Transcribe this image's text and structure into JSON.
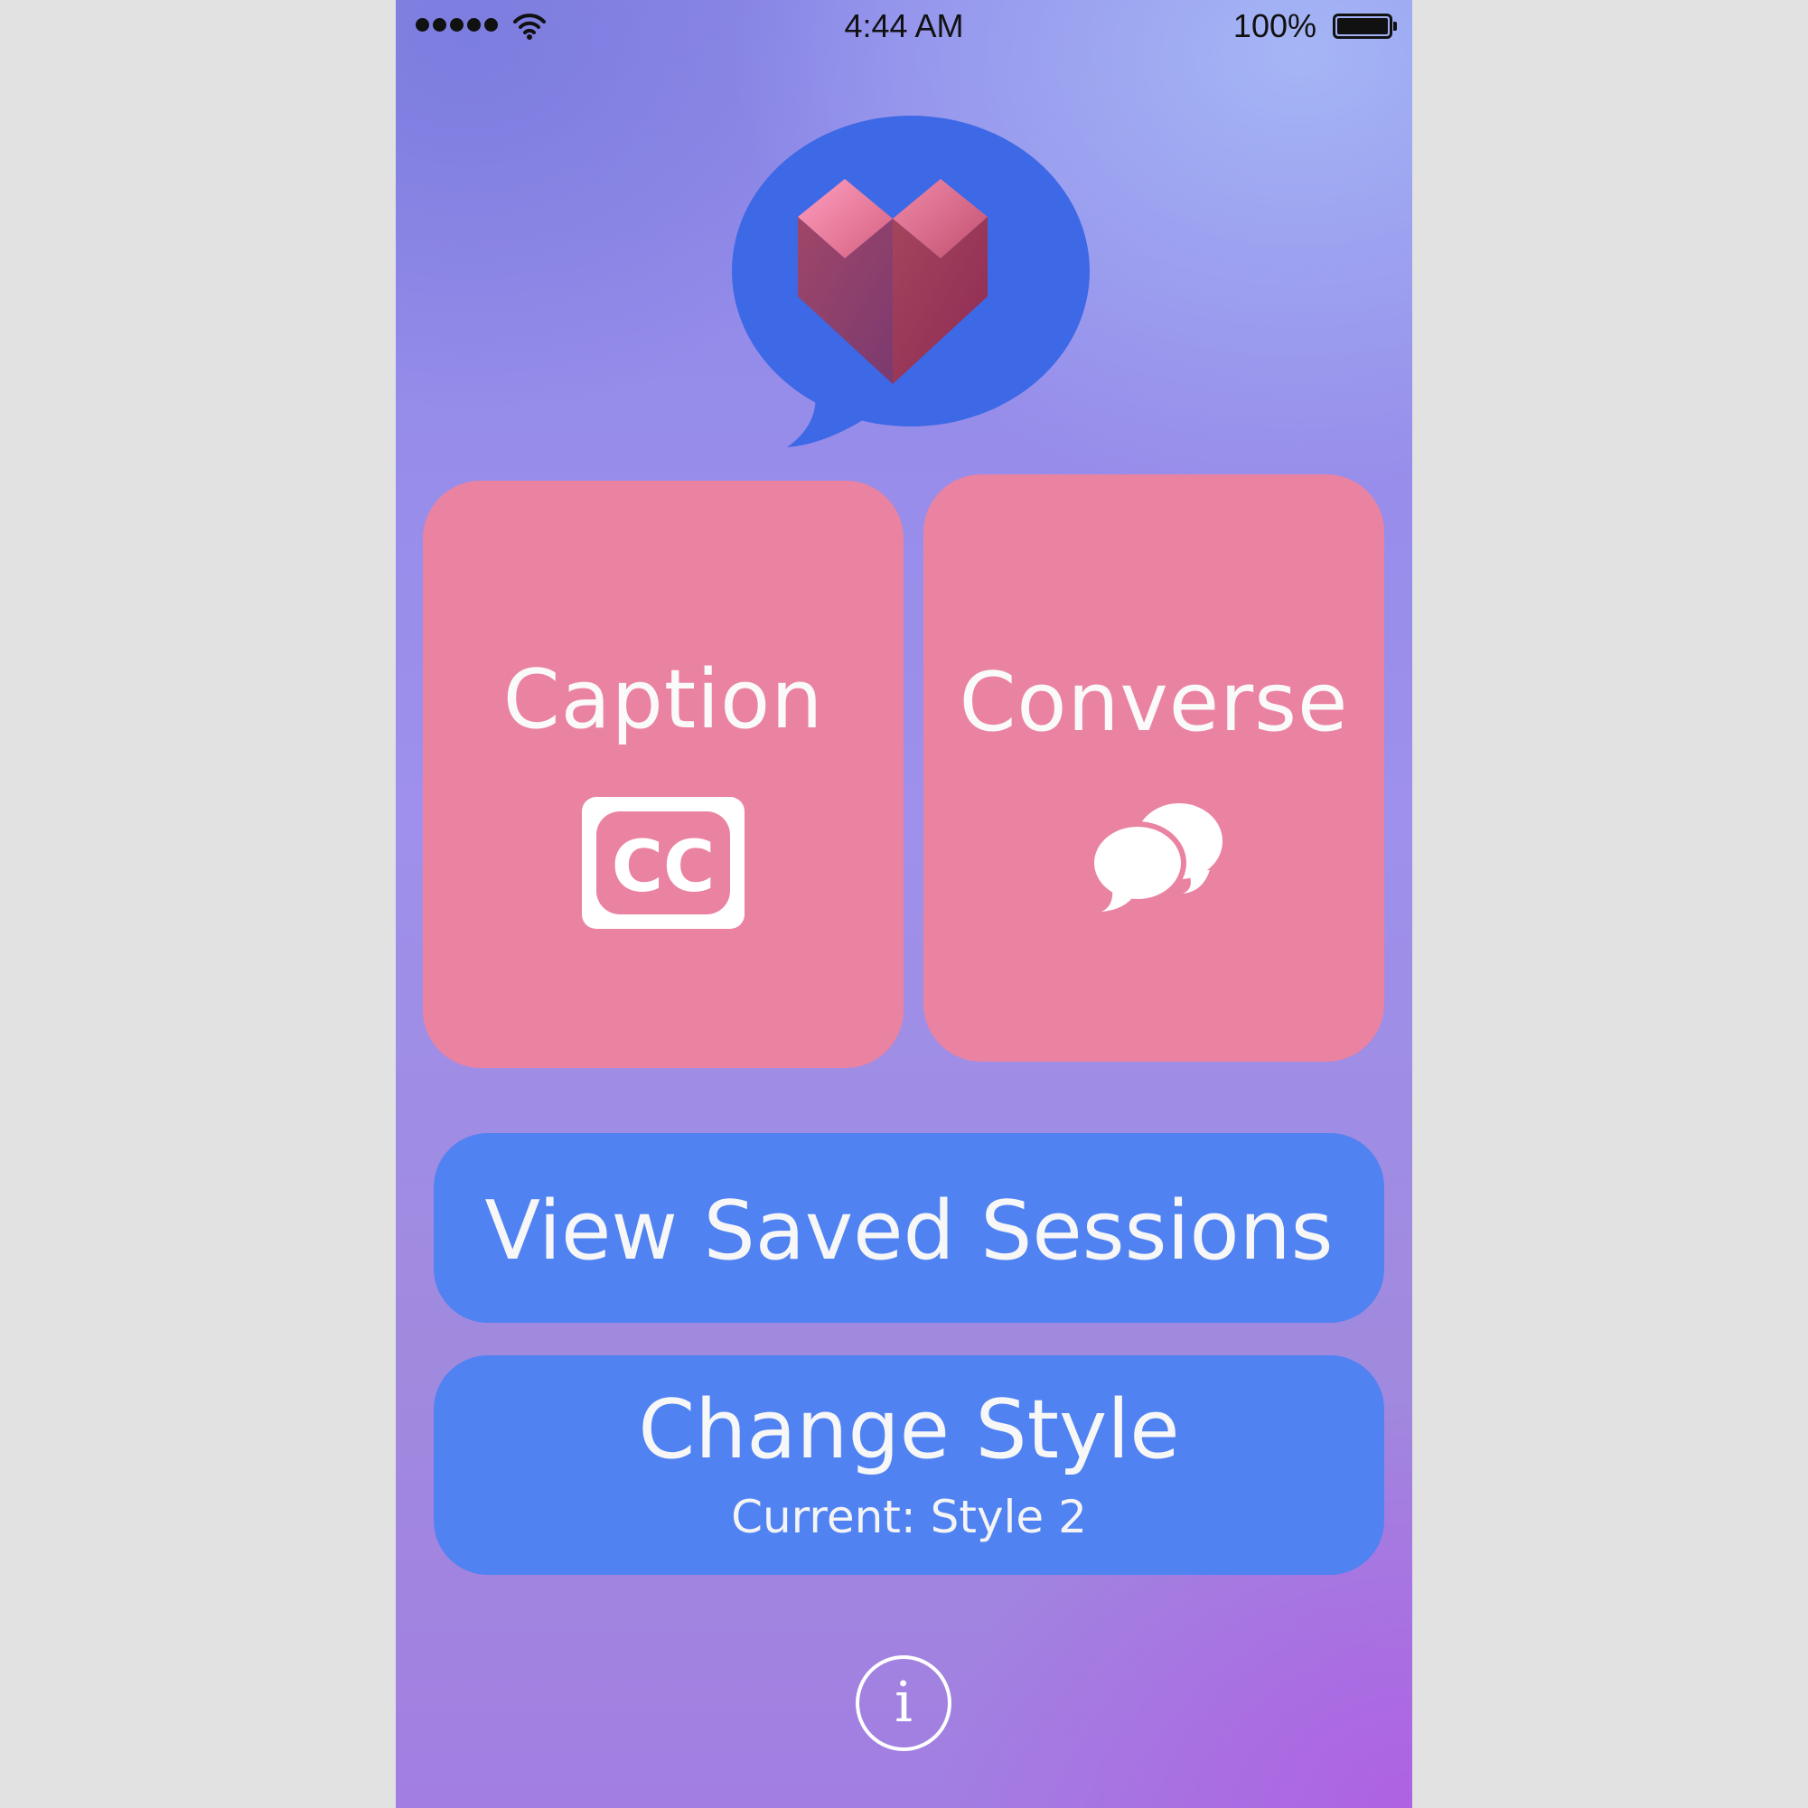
{
  "status_bar": {
    "time": "4:44 AM",
    "battery_percent": "100%",
    "signal_bars": 5,
    "battery_level": 1.0
  },
  "logo": {
    "icon": "heart-speech-bubble-icon",
    "bubble_color": "#3d68e6",
    "heart_color": "#c8506f"
  },
  "tiles": {
    "caption": {
      "label": "Caption",
      "icon": "closed-caption-icon"
    },
    "converse": {
      "label": "Converse",
      "icon": "chat-bubbles-icon"
    }
  },
  "buttons": {
    "view_sessions": {
      "label": "View Saved Sessions"
    },
    "change_style": {
      "label": "Change Style",
      "sublabel": "Current: Style 2"
    }
  },
  "info_button": {
    "glyph": "i",
    "icon": "info-icon"
  },
  "colors": {
    "tile": "#ea83a1",
    "button": "#5082f2",
    "text": "#ffffff"
  }
}
